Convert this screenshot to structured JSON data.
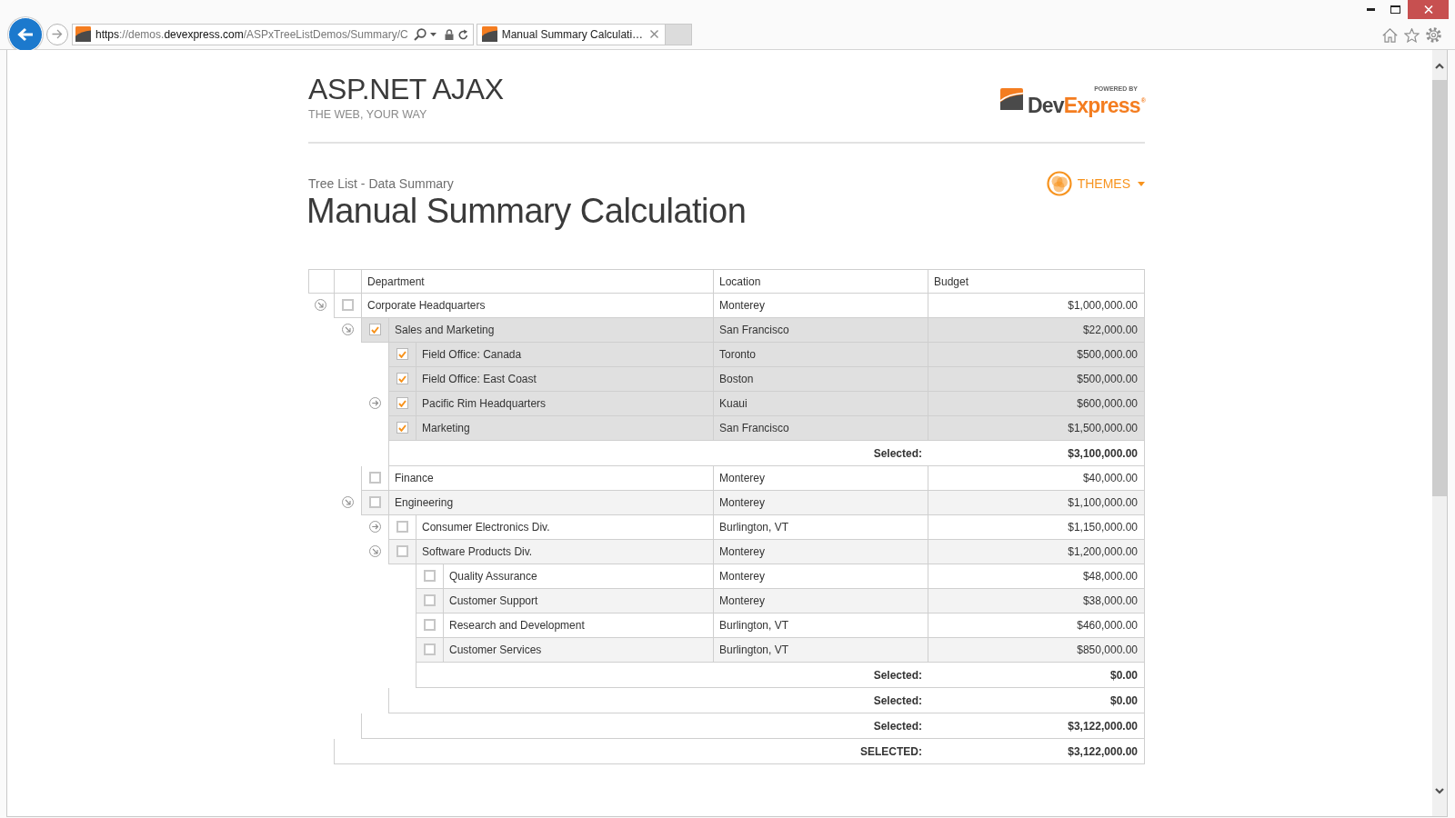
{
  "browser": {
    "address": "**https**://demos.**devexpress.com**/ASPxTreeListDemos/Summary/C",
    "tab": {
      "title": "Manual Summary Calculati…"
    }
  },
  "header": {
    "product": "ASP.NET AJAX",
    "slogan": "THE WEB, YOUR WAY",
    "logo": {
      "tagline": "POWERED BY",
      "name_start": "Dev",
      "name_end": "Express$^{®}$"
    }
  },
  "demo": {
    "breadcrumb": "Tree List - Data Summary",
    "title": "Manual Summary Calculation",
    "themes_button": "THEMES"
  },
  "tree_list": {
    "columns": [
      "Department",
      "Location",
      "Budget"
    ],
    "rows": [
      {
        "department": "Corporate Headquarters",
        "location": "Monterey",
        "budget": "$1,000,000.00",
        "selected": false,
        "expanded": true,
        "children": [
          {
            "department": "Sales and Marketing",
            "location": "San Francisco",
            "budget": "$22,000.00",
            "selected": true,
            "expanded": true,
            "children": [
              {
                "department": "Field Office: Canada",
                "location": "Toronto",
                "budget": "$500,000.00",
                "selected": true
              },
              {
                "department": "Field Office: East Coast",
                "location": "Boston",
                "budget": "$500,000.00",
                "selected": true
              },
              {
                "department": "Pacific Rim Headquarters",
                "location": "Kuaui",
                "budget": "$600,000.00",
                "selected": true,
                "expanded": false
              },
              {
                "department": "Marketing",
                "location": "San Francisco",
                "budget": "$1,500,000.00",
                "selected": true
              }
            ],
            "footer": {
              "label": "Selected:",
              "value": "$3,100,000.00"
            }
          },
          {
            "department": "Finance",
            "location": "Monterey",
            "budget": "$40,000.00",
            "selected": false
          },
          {
            "department": "Engineering",
            "location": "Monterey",
            "budget": "$1,100,000.00",
            "selected": false,
            "expanded": true,
            "children": [
              {
                "department": "Consumer Electronics Div.",
                "location": "Burlington, VT",
                "budget": "$1,150,000.00",
                "selected": false,
                "expanded": false
              },
              {
                "department": "Software Products Div.",
                "location": "Monterey",
                "budget": "$1,200,000.00",
                "selected": false,
                "expanded": true,
                "children": [
                  {
                    "department": "Quality Assurance",
                    "location": "Monterey",
                    "budget": "$48,000.00",
                    "selected": false
                  },
                  {
                    "department": "Customer Support",
                    "location": "Monterey",
                    "budget": "$38,000.00",
                    "selected": false
                  },
                  {
                    "department": "Research and Development",
                    "location": "Burlington, VT",
                    "budget": "$460,000.00",
                    "selected": false
                  },
                  {
                    "department": "Customer Services",
                    "location": "Burlington, VT",
                    "budget": "$850,000.00",
                    "selected": false
                  }
                ],
                "footer": {
                  "label": "Selected:",
                  "value": "$0.00"
                }
              }
            ],
            "footer": {
              "label": "Selected:",
              "value": "$0.00"
            }
          }
        ],
        "footer": {
          "label": "Selected:",
          "value": "$3,122,000.00"
        }
      }
    ],
    "total_footer": {
      "label": "SELECTED:",
      "value": "$3,122,000.00"
    }
  }
}
